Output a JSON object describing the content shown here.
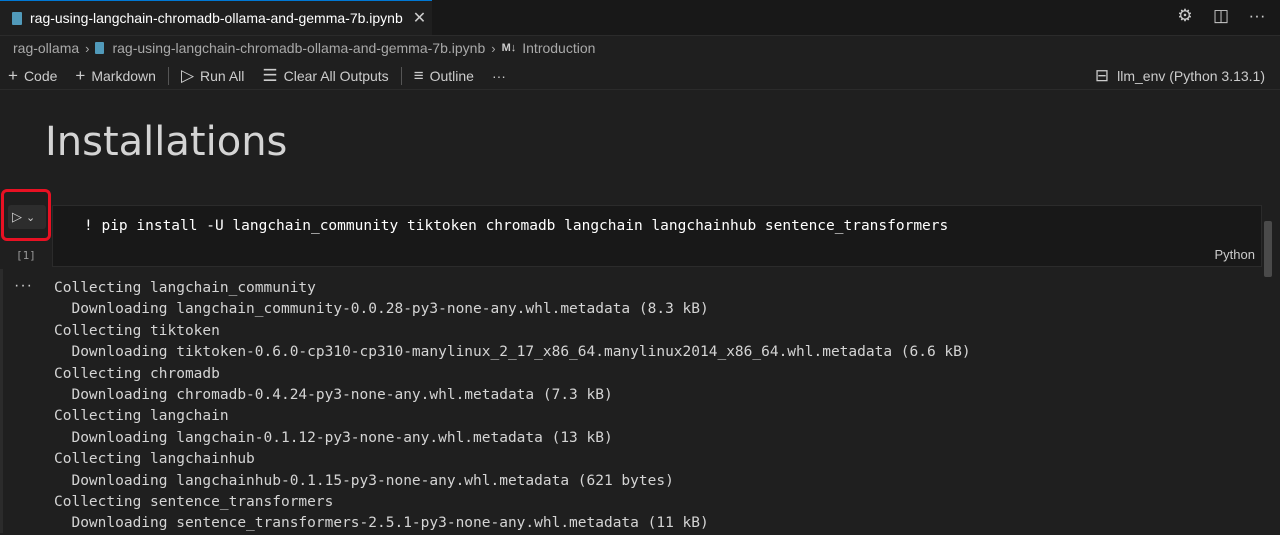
{
  "tab": {
    "title": "rag-using-langchain-chromadb-ollama-and-gemma-7b.ipynb",
    "close": "✕"
  },
  "window_actions": {
    "settings": "⚙",
    "split": "◫",
    "more": "···"
  },
  "breadcrumb": {
    "folder": "rag-ollama",
    "file": "rag-using-langchain-chromadb-ollama-and-gemma-7b.ipynb",
    "md_badge": "M↓",
    "section": "Introduction"
  },
  "toolbar": {
    "code": "Code",
    "markdown": "Markdown",
    "run_all": "Run All",
    "clear_outputs": "Clear All Outputs",
    "outline": "Outline",
    "more": "···",
    "kernel": "llm_env (Python 3.13.1)"
  },
  "markdown_cell": {
    "heading": "Installations"
  },
  "code_cell": {
    "source": "! pip install -U langchain_community tiktoken chromadb langchain langchainhub sentence_transformers",
    "execution_count": "[1]",
    "language": "Python"
  },
  "output": {
    "more": "···",
    "lines": [
      "Collecting langchain_community",
      "  Downloading langchain_community-0.0.28-py3-none-any.whl.metadata (8.3 kB)",
      "Collecting tiktoken",
      "  Downloading tiktoken-0.6.0-cp310-cp310-manylinux_2_17_x86_64.manylinux2014_x86_64.whl.metadata (6.6 kB)",
      "Collecting chromadb",
      "  Downloading chromadb-0.4.24-py3-none-any.whl.metadata (7.3 kB)",
      "Collecting langchain",
      "  Downloading langchain-0.1.12-py3-none-any.whl.metadata (13 kB)",
      "Collecting langchainhub",
      "  Downloading langchainhub-0.1.15-py3-none-any.whl.metadata (621 bytes)",
      "Collecting sentence_transformers",
      "  Downloading sentence_transformers-2.5.1-py3-none-any.whl.metadata (11 kB)"
    ]
  },
  "colors": {
    "accent": "#0078d4",
    "highlight": "#e81123",
    "background": "#1f1f1f"
  }
}
